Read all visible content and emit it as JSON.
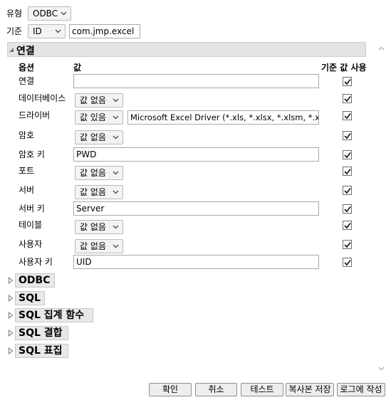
{
  "top": {
    "type_label": "유형",
    "type_value": "ODBC",
    "basis_label": "기준",
    "basis_value": "ID",
    "basis_text": "com.jmp.excel"
  },
  "section": {
    "title": "연결",
    "col_option": "옵션",
    "col_value": "값",
    "col_default": "기준 값 사용"
  },
  "rows": [
    {
      "label": "연결",
      "kind": "text",
      "value": "",
      "checked": true
    },
    {
      "label": "데이터베이스",
      "kind": "select",
      "value": "값 없음",
      "checked": true
    },
    {
      "label": "드라이버",
      "kind": "select+text",
      "value": "값 있음",
      "text": "Microsoft Excel Driver (*.xls, *.xlsx, *.xlsm, *.xlsb)",
      "checked": true
    },
    {
      "label": "암호",
      "kind": "select",
      "value": "값 없음",
      "checked": true
    },
    {
      "label": "암호 키",
      "kind": "text",
      "value": "PWD",
      "checked": true
    },
    {
      "label": "포트",
      "kind": "select",
      "value": "값 없음",
      "checked": true
    },
    {
      "label": "서버",
      "kind": "select",
      "value": "값 없음",
      "checked": true
    },
    {
      "label": "서버 키",
      "kind": "text",
      "value": "Server",
      "checked": true
    },
    {
      "label": "테이블",
      "kind": "select",
      "value": "값 없음",
      "checked": true
    },
    {
      "label": "사용자",
      "kind": "select",
      "value": "값 없음",
      "checked": true
    },
    {
      "label": "사용자 키",
      "kind": "text",
      "value": "UID",
      "checked": true
    }
  ],
  "collapsed_sections": [
    "ODBC",
    "SQL",
    "SQL 집계 함수",
    "SQL 결합",
    "SQL 표집"
  ],
  "buttons": {
    "ok": "확인",
    "cancel": "취소",
    "test": "테스트",
    "save_copy": "복사본 저장",
    "write_log": "로그에 작성"
  },
  "icons": {
    "dropdown": "chevron-down-icon",
    "expanded": "triangle-down-icon",
    "collapsed": "triangle-right-icon",
    "check": "check-icon"
  }
}
